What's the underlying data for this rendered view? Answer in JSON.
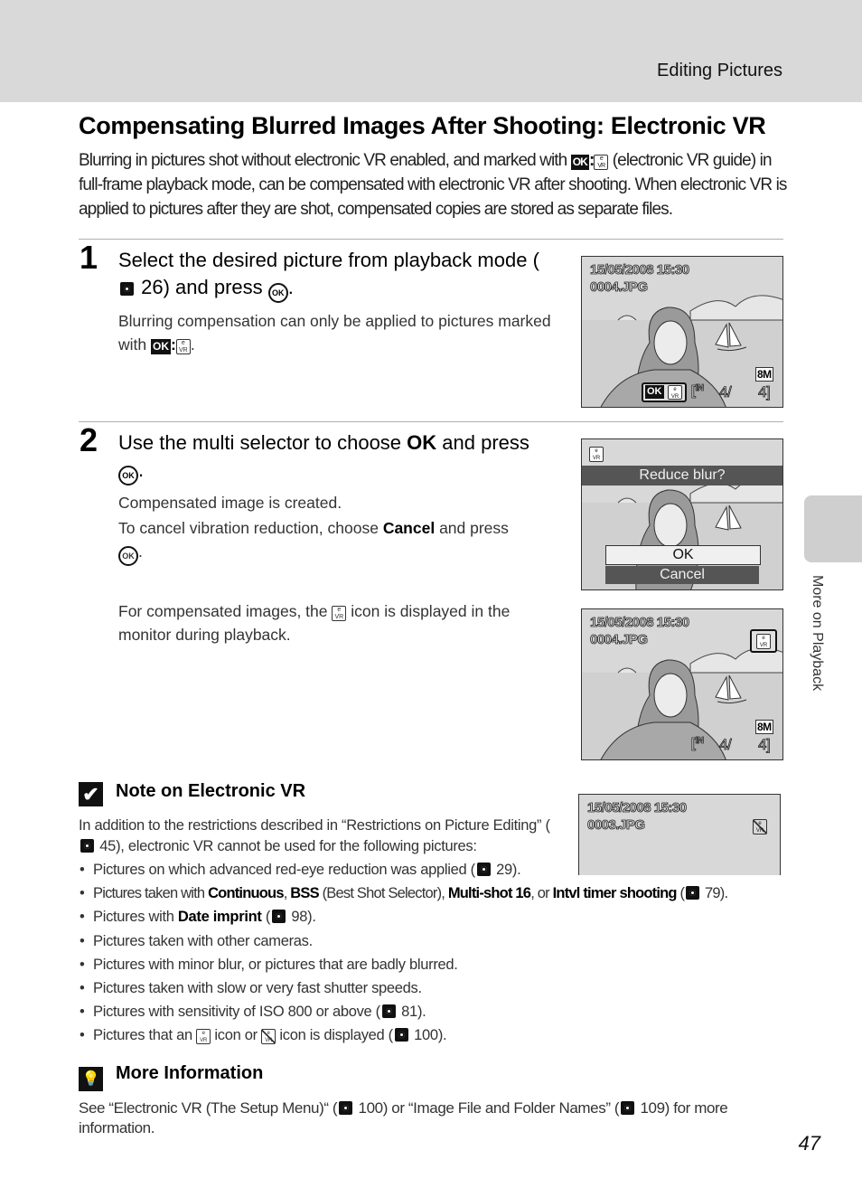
{
  "header": {
    "section_title": "Editing Pictures"
  },
  "page_title": "Compensating Blurred Images After Shooting: Electronic VR",
  "intro": {
    "before_icon": "Blurring in pictures shot without electronic VR enabled, and marked with ",
    "icon_ok": "OK",
    "after_icon": " (electronic VR guide) in full-frame playback mode, can be compensated with electronic VR after shooting. When electronic VR is applied to pictures after they are shot, compensated copies are stored as separate files."
  },
  "steps": [
    {
      "number": "1",
      "heading_a": "Select the desired picture from playback mode (",
      "heading_ref": "26",
      "heading_b": ") and press ",
      "heading_end": ".",
      "body_a": "Blurring compensation can only be applied to pictures marked with ",
      "body_end": "."
    },
    {
      "number": "2",
      "heading_a": "Use the multi selector to choose ",
      "heading_bold": "OK",
      "heading_b": " and press ",
      "heading_end": ".",
      "body_1": "Compensated image is created.",
      "body_2a": "To cancel vibration reduction, choose ",
      "body_2bold": "Cancel",
      "body_2b": " and press ",
      "body_2end": ".",
      "body_3a": "For compensated images, the ",
      "body_3b": " icon is displayed in the monitor during playback."
    }
  ],
  "screens": {
    "screen1": {
      "date": "15/05/2008 15:30",
      "file": "0004.JPG",
      "ok_label": "OK",
      "size": "8M",
      "memory": "IN",
      "counter": "4/",
      "total": "4]"
    },
    "screen2": {
      "prompt": "Reduce blur?",
      "option_ok": "OK",
      "option_cancel": "Cancel"
    },
    "screen3": {
      "date": "15/05/2008 15:30",
      "file": "0004.JPG",
      "size": "8M",
      "memory": "IN",
      "counter": "4/",
      "total": "4]"
    },
    "screen4": {
      "date": "15/05/2008 15:30",
      "file": "0003.JPG"
    }
  },
  "note": {
    "title": "Note on Electronic VR",
    "body_a": "In addition to the restrictions described in “Restrictions on Picture Editing” (",
    "body_ref": "45",
    "body_b": "), electronic VR cannot be used for the following pictures:",
    "bullets": [
      {
        "a": "Pictures on which advanced red-eye reduction was applied (",
        "ref": "29",
        "b": ")."
      },
      {
        "a": "Pictures taken with ",
        "b1": "Continuous",
        "c": ", ",
        "b2": "BSS",
        "d": " (Best Shot Selector), ",
        "b3": "Multi-shot 16",
        "e": ", or ",
        "b4": "Intvl timer shooting",
        "f": " (",
        "ref": "79",
        "g": ")."
      },
      {
        "a": "Pictures with ",
        "b1": "Date imprint",
        "c": " (",
        "ref": "98",
        "d": ")."
      },
      {
        "a": "Pictures taken with other cameras."
      },
      {
        "a": "Pictures with minor blur, or pictures that are badly blurred."
      },
      {
        "a": "Pictures taken with slow or very fast shutter speeds."
      },
      {
        "a": "Pictures with sensitivity of ISO 800 or above (",
        "ref": "81",
        "b": ")."
      },
      {
        "a": "Pictures that an ",
        "b": " icon or ",
        "c": " icon is displayed (",
        "ref": "100",
        "d": ")."
      }
    ]
  },
  "more_info": {
    "title": "More Information",
    "body_a": "See “Electronic VR (The Setup Menu)“ (",
    "ref1": "100",
    "body_b": ") or “Image File and Folder Names” (",
    "ref2": "109",
    "body_c": ") for more information."
  },
  "side_tab": {
    "label": "More on Playback"
  },
  "page_number": "47"
}
